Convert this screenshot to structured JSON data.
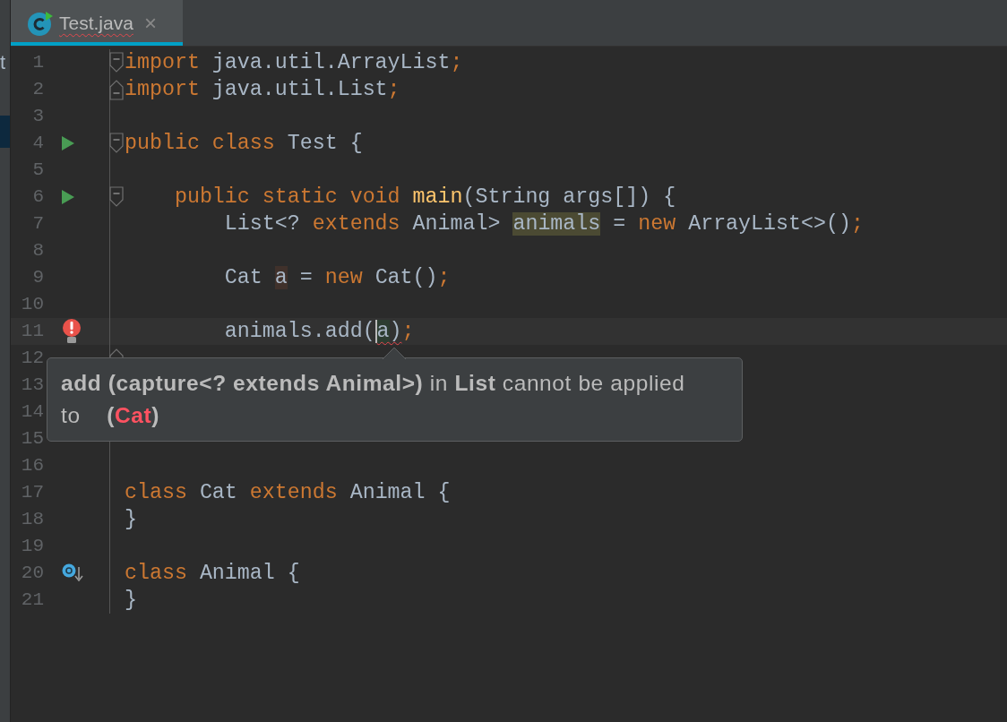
{
  "left_panel": {
    "text": "t",
    "selected_row": true
  },
  "tabs": [
    {
      "label": "Test.java",
      "selected": true,
      "has_error": true,
      "close": "×"
    }
  ],
  "lines": [
    {
      "number": "1",
      "fold_marker": {
        "kind": "start"
      },
      "tokens": [
        {
          "text": "import",
          "kind": "keyword"
        },
        {
          "text": " java.util.ArrayList",
          "kind": "plain"
        },
        {
          "text": ";",
          "kind": "keyword"
        }
      ]
    },
    {
      "number": "2",
      "fold_marker": {
        "kind": "end"
      },
      "tokens": [
        {
          "text": "import",
          "kind": "keyword"
        },
        {
          "text": " java.util.List",
          "kind": "plain"
        },
        {
          "text": ";",
          "kind": "keyword"
        }
      ]
    },
    {
      "number": "3"
    },
    {
      "number": "4",
      "gutter_icon": {
        "kind": "run"
      },
      "fold_marker": {
        "kind": "start"
      },
      "tokens": [
        {
          "text": "public class",
          "kind": "keyword"
        },
        {
          "text": " Test {",
          "kind": "plain"
        }
      ]
    },
    {
      "number": "5"
    },
    {
      "number": "6",
      "gutter_icon": {
        "kind": "run"
      },
      "fold_marker": {
        "kind": "start"
      },
      "tokens": [
        {
          "text": "    public static void ",
          "kind": "keyword"
        },
        {
          "text": "main",
          "kind": "method"
        },
        {
          "text": "(String args[]) {",
          "kind": "plain"
        }
      ]
    },
    {
      "number": "7",
      "tokens": [
        {
          "text": "        List<? ",
          "kind": "plain"
        },
        {
          "text": "extends",
          "kind": "keyword"
        },
        {
          "text": " Animal> ",
          "kind": "plain"
        },
        {
          "text": "animals",
          "kind": "write_usage"
        },
        {
          "text": " = ",
          "kind": "plain"
        },
        {
          "text": "new",
          "kind": "keyword"
        },
        {
          "text": " ArrayList<>()",
          "kind": "plain"
        },
        {
          "text": ";",
          "kind": "keyword"
        }
      ]
    },
    {
      "number": "8"
    },
    {
      "number": "9",
      "tokens": [
        {
          "text": "        Cat ",
          "kind": "plain"
        },
        {
          "text": "a",
          "kind": "read_usage"
        },
        {
          "text": " = ",
          "kind": "plain"
        },
        {
          "text": "new",
          "kind": "keyword"
        },
        {
          "text": " Cat()",
          "kind": "plain"
        },
        {
          "text": ";",
          "kind": "keyword"
        }
      ]
    },
    {
      "number": "10"
    },
    {
      "number": "11",
      "gutter_icon": {
        "kind": "bulb"
      },
      "current": true,
      "tokens": [
        {
          "text": "        animals.add(",
          "kind": "plain"
        },
        {
          "text": "a",
          "kind": "caret_usage",
          "error": true
        },
        {
          "text": ")",
          "kind": "plain",
          "error": true
        },
        {
          "text": ";",
          "kind": "keyword"
        }
      ]
    },
    {
      "number": "12",
      "fold_marker": {
        "kind": "end"
      }
    },
    {
      "number": "13"
    },
    {
      "number": "14"
    },
    {
      "number": "15"
    },
    {
      "number": "16"
    },
    {
      "number": "17",
      "tokens": [
        {
          "text": "class",
          "kind": "keyword"
        },
        {
          "text": " Cat ",
          "kind": "plain"
        },
        {
          "text": "extends",
          "kind": "keyword"
        },
        {
          "text": " Animal {",
          "kind": "plain"
        }
      ]
    },
    {
      "number": "18",
      "tokens": [
        {
          "text": "}",
          "kind": "plain"
        }
      ]
    },
    {
      "number": "19"
    },
    {
      "number": "20",
      "gutter_icon": {
        "kind": "override"
      },
      "tokens": [
        {
          "text": "class",
          "kind": "keyword"
        },
        {
          "text": " Animal {",
          "kind": "plain"
        }
      ]
    },
    {
      "number": "21",
      "tokens": [
        {
          "text": "}",
          "kind": "plain"
        }
      ]
    }
  ],
  "tooltip": {
    "segments": [
      {
        "text": "add (capture<? extends Animal>)",
        "kind": "bold"
      },
      {
        "text": " in ",
        "kind": "plain"
      },
      {
        "text": "List",
        "kind": "bold"
      },
      {
        "text": " cannot be applied to    ",
        "kind": "plain"
      },
      {
        "text": "(",
        "kind": "bold"
      },
      {
        "text": "Cat",
        "kind": "error"
      },
      {
        "text": ")",
        "kind": "bold"
      }
    ]
  }
}
